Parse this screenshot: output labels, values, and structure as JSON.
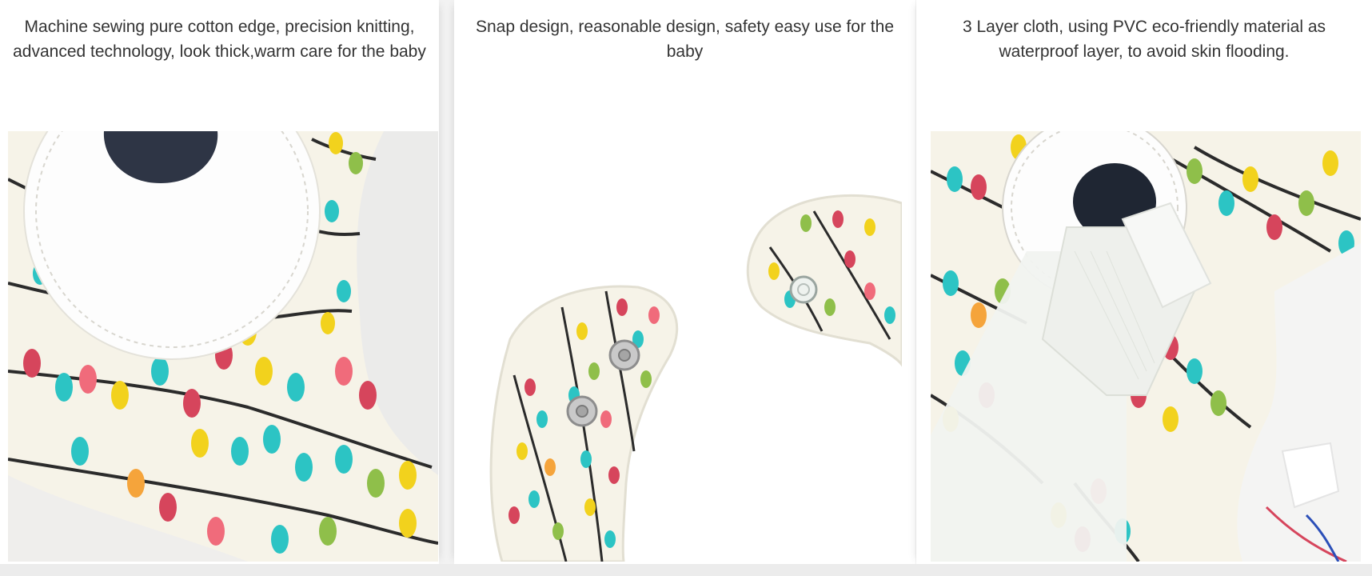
{
  "features": [
    {
      "caption": "Machine sewing pure cotton edge, precision knitting, advanced technology, look thick,warm care for the baby",
      "image_name": "cotton-edge-closeup-photo"
    },
    {
      "caption": "Snap design, reasonable design, safety easy use for the baby",
      "image_name": "snap-buttons-photo"
    },
    {
      "caption": "3 Layer cloth, using PVC eco-friendly material as waterproof layer, to avoid skin flooding.",
      "image_name": "velcro-waterproof-layer-photo"
    }
  ],
  "colors": {
    "fabric": "#f6f3e8",
    "vine": "#2b2b2b",
    "patch": "#2e3545",
    "red": "#d6455c",
    "teal": "#2cc4c4",
    "yellow": "#f2d21d",
    "green": "#8fbf4a",
    "orange": "#f5a43b"
  }
}
